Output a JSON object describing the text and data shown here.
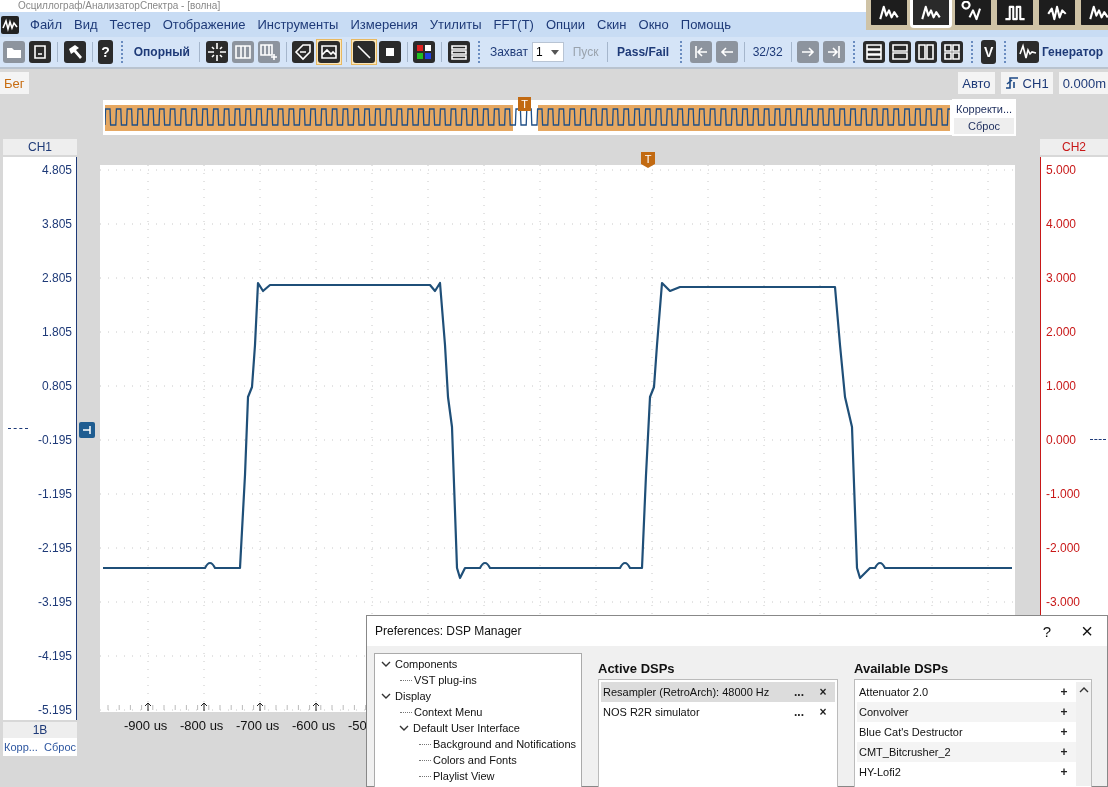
{
  "window": {
    "title": "Осциллограф/АнализаторСпектра - [волна]"
  },
  "mode_buttons": [
    {
      "selected": false
    },
    {
      "selected": true
    },
    {
      "selected": false
    },
    {
      "selected": false
    },
    {
      "selected": false
    },
    {
      "selected": false
    }
  ],
  "menu": [
    "Файл",
    "Вид",
    "Тестер",
    "Отображение",
    "Инструменты",
    "Измерения",
    "Утилиты",
    "FFT(T)",
    "Опции",
    "Скин",
    "Окно",
    "Помощь"
  ],
  "toolbar": [
    {
      "kind": "icon",
      "selected": false,
      "disabled": true
    },
    {
      "kind": "icon",
      "selected": false,
      "disabled": false
    },
    {
      "kind": "sep"
    },
    {
      "kind": "icon",
      "selected": false,
      "disabled": false
    },
    {
      "kind": "sep"
    },
    {
      "kind": "glyph",
      "label": "?",
      "selected": false,
      "disabled": false
    },
    {
      "kind": "group"
    },
    {
      "kind": "text",
      "label": "Опорный",
      "selected": false,
      "disabled": false
    },
    {
      "kind": "sep"
    },
    {
      "kind": "icon",
      "selected": false,
      "disabled": false
    },
    {
      "kind": "icon",
      "selected": false,
      "disabled": true
    },
    {
      "kind": "icon",
      "selected": false,
      "disabled": true
    },
    {
      "kind": "sep"
    },
    {
      "kind": "icon",
      "selected": false,
      "disabled": false
    },
    {
      "kind": "icon",
      "selected": true,
      "disabled": false
    },
    {
      "kind": "sep"
    },
    {
      "kind": "icon",
      "selected": true,
      "disabled": false
    },
    {
      "kind": "icon",
      "selected": false,
      "disabled": false
    },
    {
      "kind": "sep"
    },
    {
      "kind": "icon",
      "selected": false,
      "disabled": false
    },
    {
      "kind": "sep"
    },
    {
      "kind": "icon",
      "selected": false,
      "disabled": false
    },
    {
      "kind": "group"
    },
    {
      "kind": "label",
      "label": "Захват"
    },
    {
      "kind": "field",
      "value": "1"
    },
    {
      "kind": "text",
      "label": "Пуск",
      "selected": false,
      "disabled": true
    },
    {
      "kind": "sep"
    },
    {
      "kind": "text",
      "label": "Pass/Fail",
      "selected": false,
      "disabled": false
    },
    {
      "kind": "group"
    },
    {
      "kind": "icon",
      "selected": false,
      "disabled": true
    },
    {
      "kind": "icon",
      "selected": false,
      "disabled": true
    },
    {
      "kind": "sep"
    },
    {
      "kind": "label",
      "label": "32/32"
    },
    {
      "kind": "sep"
    },
    {
      "kind": "icon",
      "selected": false,
      "disabled": true
    },
    {
      "kind": "icon",
      "selected": false,
      "disabled": true
    },
    {
      "kind": "group"
    },
    {
      "kind": "icon",
      "selected": false,
      "disabled": false
    },
    {
      "kind": "icon",
      "selected": false,
      "disabled": false
    },
    {
      "kind": "icon",
      "selected": false,
      "disabled": false
    },
    {
      "kind": "icon",
      "selected": false,
      "disabled": false
    },
    {
      "kind": "group"
    },
    {
      "kind": "glyph",
      "label": "V",
      "selected": false,
      "disabled": false
    },
    {
      "kind": "group"
    },
    {
      "kind": "text-icon",
      "label": "Генератор",
      "selected": false,
      "disabled": false
    }
  ],
  "status": {
    "run_state": "Бег",
    "trigger_mode": "Авто",
    "trigger_channel": "CH1",
    "trigger_level": "0.000m"
  },
  "overview": {
    "trigger_marker": "T",
    "buttons": [
      "Корректи...",
      "Сброс"
    ]
  },
  "ch1_axis": {
    "title": "CH1",
    "ticks": [
      "4.805",
      "3.805",
      "2.805",
      "1.805",
      "0.805",
      "-0.195",
      "-1.195",
      "-2.195",
      "-3.195",
      "-4.195",
      "-5.195"
    ],
    "scale": "1В",
    "links": [
      "Корр...",
      "Сброс"
    ]
  },
  "plot": {
    "trigger_marker": "T"
  },
  "ch2_axis": {
    "title": "CH2",
    "ticks": [
      "5.000",
      "4.000",
      "3.000",
      "2.000",
      "1.000",
      "0.000",
      "-1.000",
      "-2.000",
      "-3.000"
    ]
  },
  "x_axis": {
    "ticks": [
      "-900 us",
      "-800 us",
      "-700 us",
      "-600 us",
      "-50"
    ]
  },
  "dialog": {
    "title": "Preferences: DSP Manager",
    "help": "?",
    "close": "×",
    "tree": [
      {
        "label": "Components",
        "expanded": true,
        "children": [
          {
            "label": "VST plug-ins"
          }
        ]
      },
      {
        "label": "Display",
        "expanded": true,
        "children": [
          {
            "label": "Context Menu"
          },
          {
            "label": "Default User Interface",
            "expanded": true,
            "children": [
              {
                "label": "Background and Notifications"
              },
              {
                "label": "Colors and Fonts"
              },
              {
                "label": "Playlist View"
              }
            ]
          }
        ]
      }
    ],
    "active": {
      "heading": "Active DSPs",
      "items": [
        {
          "label": "Resampler (RetroArch): 48000 Hz",
          "selected": true,
          "configure": "...",
          "remove": "×"
        },
        {
          "label": "NOS R2R simulator",
          "selected": false,
          "configure": "...",
          "remove": "×"
        }
      ]
    },
    "available": {
      "heading": "Available DSPs",
      "items": [
        {
          "label": "Attenuator 2.0",
          "add": "+"
        },
        {
          "label": "Convolver",
          "add": "+"
        },
        {
          "label": "Blue Cat's Destructor",
          "add": "+"
        },
        {
          "label": "CMT_Bitcrusher_2",
          "add": "+"
        },
        {
          "label": "HY-Lofi2",
          "add": "+"
        }
      ]
    }
  }
}
